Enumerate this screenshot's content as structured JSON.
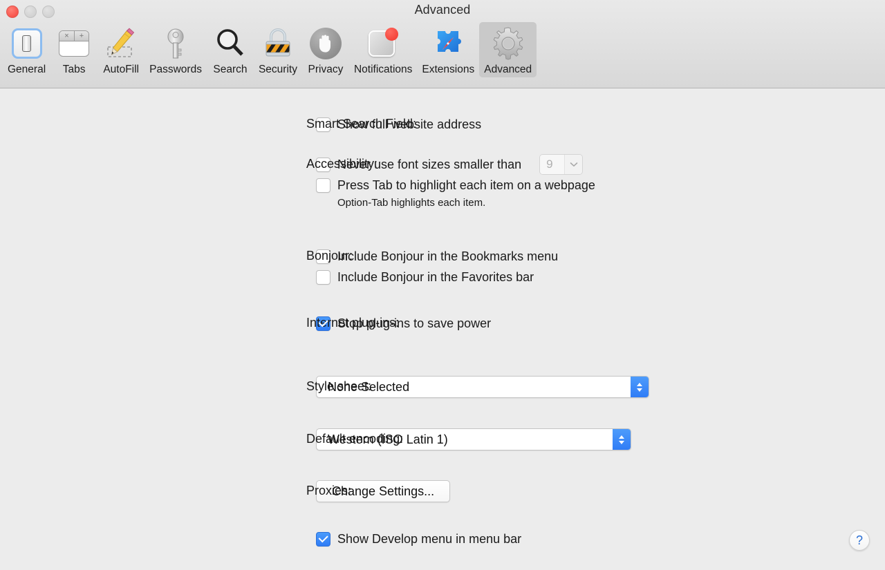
{
  "window": {
    "title": "Advanced",
    "traffic_lights": [
      {
        "name": "close-button",
        "color": "#f8554d"
      },
      {
        "name": "minimize-button",
        "color": "#d2d2d2"
      },
      {
        "name": "zoom-button",
        "color": "#d2d2d2"
      }
    ]
  },
  "toolbar": {
    "selected": "Advanced",
    "items": [
      {
        "label": "General",
        "icon": "general-icon"
      },
      {
        "label": "Tabs",
        "icon": "tabs-icon"
      },
      {
        "label": "AutoFill",
        "icon": "pencil-icon"
      },
      {
        "label": "Passwords",
        "icon": "key-icon"
      },
      {
        "label": "Search",
        "icon": "magnifier-icon"
      },
      {
        "label": "Security",
        "icon": "padlock-icon"
      },
      {
        "label": "Privacy",
        "icon": "hand-icon"
      },
      {
        "label": "Notifications",
        "icon": "notification-badge-icon"
      },
      {
        "label": "Extensions",
        "icon": "puzzle-compass-icon"
      },
      {
        "label": "Advanced",
        "icon": "gear-icon"
      }
    ],
    "tabs_icon_glyphs": {
      "close": "×",
      "add": "+"
    }
  },
  "form": {
    "smart_search": {
      "label": "Smart Search Field:",
      "checkbox_label": "Show full website address",
      "checked": false
    },
    "accessibility": {
      "label": "Accessibility:",
      "font_size_checkbox_label": "Never use font sizes smaller than",
      "font_size_checked": false,
      "font_size_value": "9",
      "font_size_disabled": true,
      "tab_highlight_checkbox_label": "Press Tab to highlight each item on a webpage",
      "tab_highlight_checked": false,
      "hint": "Option-Tab highlights each item."
    },
    "bonjour": {
      "label": "Bonjour:",
      "bookmarks_checkbox_label": "Include Bonjour in the Bookmarks menu",
      "bookmarks_checked": false,
      "favorites_checkbox_label": "Include Bonjour in the Favorites bar",
      "favorites_checked": false
    },
    "plugins": {
      "label": "Internet plug-ins:",
      "checkbox_label": "Stop plug-ins to save power",
      "checked": true
    },
    "style_sheet": {
      "label": "Style sheet:",
      "value": "None Selected"
    },
    "default_encoding": {
      "label": "Default encoding:",
      "value": "Western (ISO Latin 1)"
    },
    "proxies": {
      "label": "Proxies:",
      "button_label": "Change Settings..."
    },
    "develop_menu": {
      "checkbox_label": "Show Develop menu in menu bar",
      "checked": true
    }
  },
  "help": {
    "glyph": "?"
  },
  "colors": {
    "window_background": "#ececec",
    "toolbar_background": "#dedede",
    "accent_blue": "#2f7cf6",
    "close_red": "#f8554d",
    "text": "#1a1a1a",
    "disabled_text": "#b0b0b0"
  }
}
